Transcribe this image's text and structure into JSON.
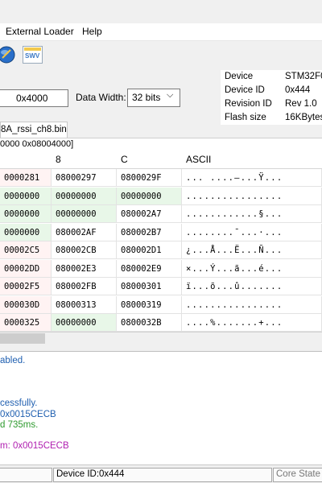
{
  "menu": {
    "external_loader": "External Loader",
    "help": "Help"
  },
  "toolbar": {
    "swv_label": "SWV"
  },
  "params": {
    "size_value": "0x4000",
    "data_width_label": "Data Width:",
    "data_width_value": "32 bits"
  },
  "device_info": [
    {
      "label": "Device",
      "value": "STM32F0"
    },
    {
      "label": "Device ID",
      "value": "0x444"
    },
    {
      "label": "Revision ID",
      "value": "Rev 1.0"
    },
    {
      "label": "Flash size",
      "value": "16KBytes"
    }
  ],
  "file_tab": "8A_rssi_ch8.bin",
  "address_range": "0000 0x08004000]",
  "memory": {
    "columns": [
      "",
      "8",
      "C",
      "ASCII"
    ],
    "rows": [
      {
        "c4": "0000281",
        "c8": "08000297",
        "cc": "0800029F",
        "ascii": "...  ....—...Ÿ...",
        "hl": [
          false,
          false,
          false
        ]
      },
      {
        "c4": "0000000",
        "c8": "00000000",
        "cc": "00000000",
        "ascii": "................",
        "hl": [
          true,
          true,
          true
        ]
      },
      {
        "c4": "0000000",
        "c8": "00000000",
        "cc": "080002A7",
        "ascii": "............§...",
        "hl": [
          true,
          true,
          false
        ]
      },
      {
        "c4": "0000000",
        "c8": "080002AF",
        "cc": "080002B7",
        "ascii": "........¯...·...",
        "hl": [
          true,
          false,
          false
        ]
      },
      {
        "c4": "00002C5",
        "c8": "080002CB",
        "cc": "080002D1",
        "ascii": "¿...Å...Ë...Ñ...",
        "hl": [
          false,
          false,
          false
        ]
      },
      {
        "c4": "00002DD",
        "c8": "080002E3",
        "cc": "080002E9",
        "ascii": "×...Ý...ã...é...",
        "hl": [
          false,
          false,
          false
        ]
      },
      {
        "c4": "00002F5",
        "c8": "080002FB",
        "cc": "08000301",
        "ascii": "ï...õ...û.......",
        "hl": [
          false,
          false,
          false
        ]
      },
      {
        "c4": "000030D",
        "c8": "08000313",
        "cc": "08000319",
        "ascii": "................",
        "hl": [
          false,
          false,
          false
        ]
      },
      {
        "c4": "0000325",
        "c8": "00000000",
        "cc": "0800032B",
        "ascii": "....%.......+...",
        "hl": [
          false,
          true,
          false
        ]
      }
    ]
  },
  "log": [
    {
      "text": "abled.",
      "color": "#1f5fb0"
    },
    {
      "text": "",
      "color": "#000000"
    },
    {
      "text": "",
      "color": "#000000"
    },
    {
      "text": "cessfully.",
      "color": "#1f5fb0"
    },
    {
      "text": "0x0015CECB",
      "color": "#1f5fb0"
    },
    {
      "text": "d 735ms.",
      "color": "#2e9a2e"
    },
    {
      "text": "",
      "color": "#000000"
    },
    {
      "text": "m: 0x0015CECB",
      "color": "#b01fb0"
    }
  ],
  "status": {
    "device_id": "Device ID:0x444",
    "core_state": "Core State :"
  },
  "colors": {
    "highlight_green": "#e8f7e8",
    "address_pink": "#fff3f3"
  }
}
